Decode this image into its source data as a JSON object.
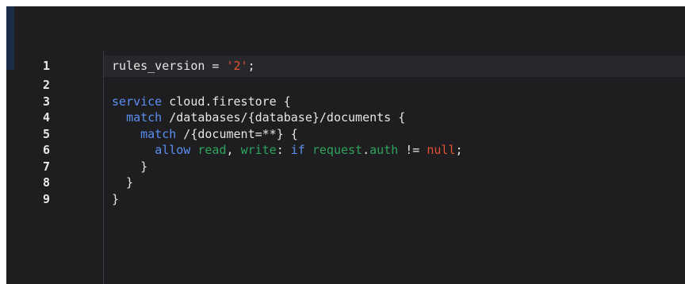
{
  "colors": {
    "background": "#1e1e21",
    "keyword": "#5b8ff0",
    "string": "#e2502f",
    "green": "#2ea35a",
    "null": "#e2502f",
    "plain": "#e6e6e6"
  },
  "editor": {
    "line_numbers": [
      "1",
      "2",
      "3",
      "4",
      "5",
      "6",
      "7",
      "8",
      "9"
    ],
    "lines": [
      [
        {
          "text": "rules_version = ",
          "kind": "pl"
        },
        {
          "text": "'2'",
          "kind": "st"
        },
        {
          "text": ";",
          "kind": "pl"
        }
      ],
      [],
      [
        {
          "text": "service",
          "kind": "kw"
        },
        {
          "text": " cloud.firestore {",
          "kind": "pl"
        }
      ],
      [
        {
          "text": "  ",
          "kind": "pl"
        },
        {
          "text": "match",
          "kind": "kw"
        },
        {
          "text": " /databases/{database}/documents {",
          "kind": "pl"
        }
      ],
      [
        {
          "text": "    ",
          "kind": "pl"
        },
        {
          "text": "match",
          "kind": "kw"
        },
        {
          "text": " /{document=**} {",
          "kind": "pl"
        }
      ],
      [
        {
          "text": "      ",
          "kind": "pl"
        },
        {
          "text": "allow",
          "kind": "kw"
        },
        {
          "text": " ",
          "kind": "pl"
        },
        {
          "text": "read",
          "kind": "gr"
        },
        {
          "text": ", ",
          "kind": "pl"
        },
        {
          "text": "write",
          "kind": "gr"
        },
        {
          "text": ": ",
          "kind": "pl"
        },
        {
          "text": "if",
          "kind": "kw"
        },
        {
          "text": " ",
          "kind": "pl"
        },
        {
          "text": "request",
          "kind": "gr"
        },
        {
          "text": ".",
          "kind": "pl"
        },
        {
          "text": "auth",
          "kind": "gr"
        },
        {
          "text": " != ",
          "kind": "pl"
        },
        {
          "text": "null",
          "kind": "nl"
        },
        {
          "text": ";",
          "kind": "pl"
        }
      ],
      [
        {
          "text": "    }",
          "kind": "pl"
        }
      ],
      [
        {
          "text": "  }",
          "kind": "pl"
        }
      ],
      [
        {
          "text": "}",
          "kind": "pl"
        }
      ]
    ]
  }
}
